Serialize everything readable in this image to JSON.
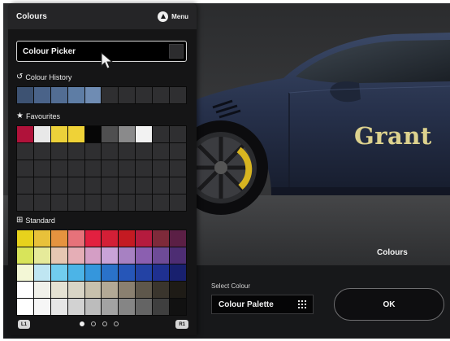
{
  "panel": {
    "title": "Colours",
    "menu_label": "Menu",
    "picker_label": "Colour Picker",
    "history_label": "Colour History",
    "favourites_label": "Favourites",
    "standard_label": "Standard",
    "history": [
      "#3d5272",
      "#4a6389",
      "#526d93",
      "#5e7da5",
      "#6f8cb3",
      "#2f2f31",
      "#2f2f31",
      "#2f2f31",
      "#2f2f31",
      "#2f2f31"
    ],
    "favourites": [
      "#b0123a",
      "#e8e8e8",
      "#ecd13a",
      "#efd237",
      "#060606",
      "#4f4f50",
      "#8a8a8b",
      "#f2f2f2",
      "#2f2f31",
      "#2f2f31",
      "#2f2f31",
      "#2f2f31",
      "#2f2f31",
      "#2f2f31",
      "#2f2f31",
      "#2f2f31",
      "#2f2f31",
      "#2f2f31",
      "#2f2f31",
      "#2f2f31",
      "#2f2f31",
      "#2f2f31",
      "#2f2f31",
      "#2f2f31",
      "#2f2f31",
      "#2f2f31",
      "#2f2f31",
      "#2f2f31",
      "#2f2f31",
      "#2f2f31",
      "#2f2f31",
      "#2f2f31",
      "#2f2f31",
      "#2f2f31",
      "#2f2f31",
      "#2f2f31",
      "#2f2f31",
      "#2f2f31",
      "#2f2f31",
      "#2f2f31",
      "#2f2f31",
      "#2f2f31",
      "#2f2f31",
      "#2f2f31",
      "#2f2f31",
      "#2f2f31",
      "#2f2f31",
      "#2f2f31",
      "#2f2f31",
      "#2f2f31"
    ],
    "standard": [
      "#e7d21c",
      "#e8c13a",
      "#e5933f",
      "#e6727a",
      "#e22040",
      "#d31f36",
      "#c41a22",
      "#b51b3e",
      "#7e2a3a",
      "#5b1f45",
      "#d8e45a",
      "#e6ea9a",
      "#e6c7b2",
      "#e5aeb6",
      "#d49ec5",
      "#c9a3d8",
      "#a781c2",
      "#8b5fb0",
      "#6e4b97",
      "#4d2d73",
      "#f3f7d6",
      "#bfe6f2",
      "#71cdee",
      "#4cb4e7",
      "#3596dc",
      "#2a72c9",
      "#2656b8",
      "#2342a4",
      "#1f3090",
      "#18206e",
      "#ffffff",
      "#f1f1ea",
      "#e5e2d3",
      "#d9d5c6",
      "#c8c1ad",
      "#b3a996",
      "#8a8070",
      "#5e574b",
      "#3a352d",
      "#1e1b16",
      "#ffffff",
      "#f6f6f6",
      "#e6e6e6",
      "#d2d2d2",
      "#bcbcbc",
      "#a3a3a3",
      "#858585",
      "#646464",
      "#3f3f3f",
      "#111111"
    ],
    "l1": "L1",
    "r1": "R1",
    "pages": 4,
    "active_page": 0
  },
  "scene": {
    "decal_text": "Grant",
    "colours_label": "Colours",
    "car_color": "#26304a"
  },
  "bottom": {
    "select_colour_label": "Select Colour",
    "palette_value": "Colour Palette",
    "ok_label": "OK"
  }
}
